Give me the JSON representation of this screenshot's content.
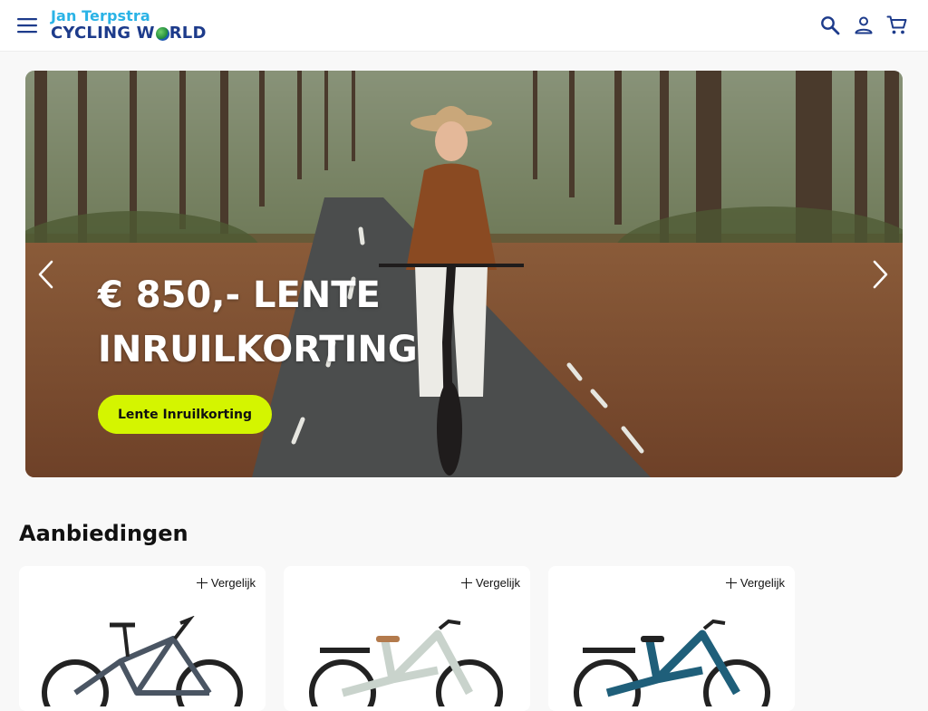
{
  "header": {
    "logo_line1": "Jan Terpstra",
    "logo_line2_a": "CYCLING W",
    "logo_line2_b": "RLD",
    "icons": [
      "menu-icon",
      "search-icon",
      "account-icon",
      "cart-icon"
    ]
  },
  "hero": {
    "title": "€ 850,- LENTE INRUILKORTING",
    "cta_label": "Lente Inruilkorting",
    "accent_color": "#d4f500"
  },
  "offers": {
    "title": "Aanbiedingen",
    "products": [
      {
        "compare_label": "Vergelijk",
        "frame_color": "#4a5563"
      },
      {
        "compare_label": "Vergelijk",
        "frame_color": "#c9d3cc"
      },
      {
        "compare_label": "Vergelijk",
        "frame_color": "#1f5f7a"
      }
    ]
  }
}
